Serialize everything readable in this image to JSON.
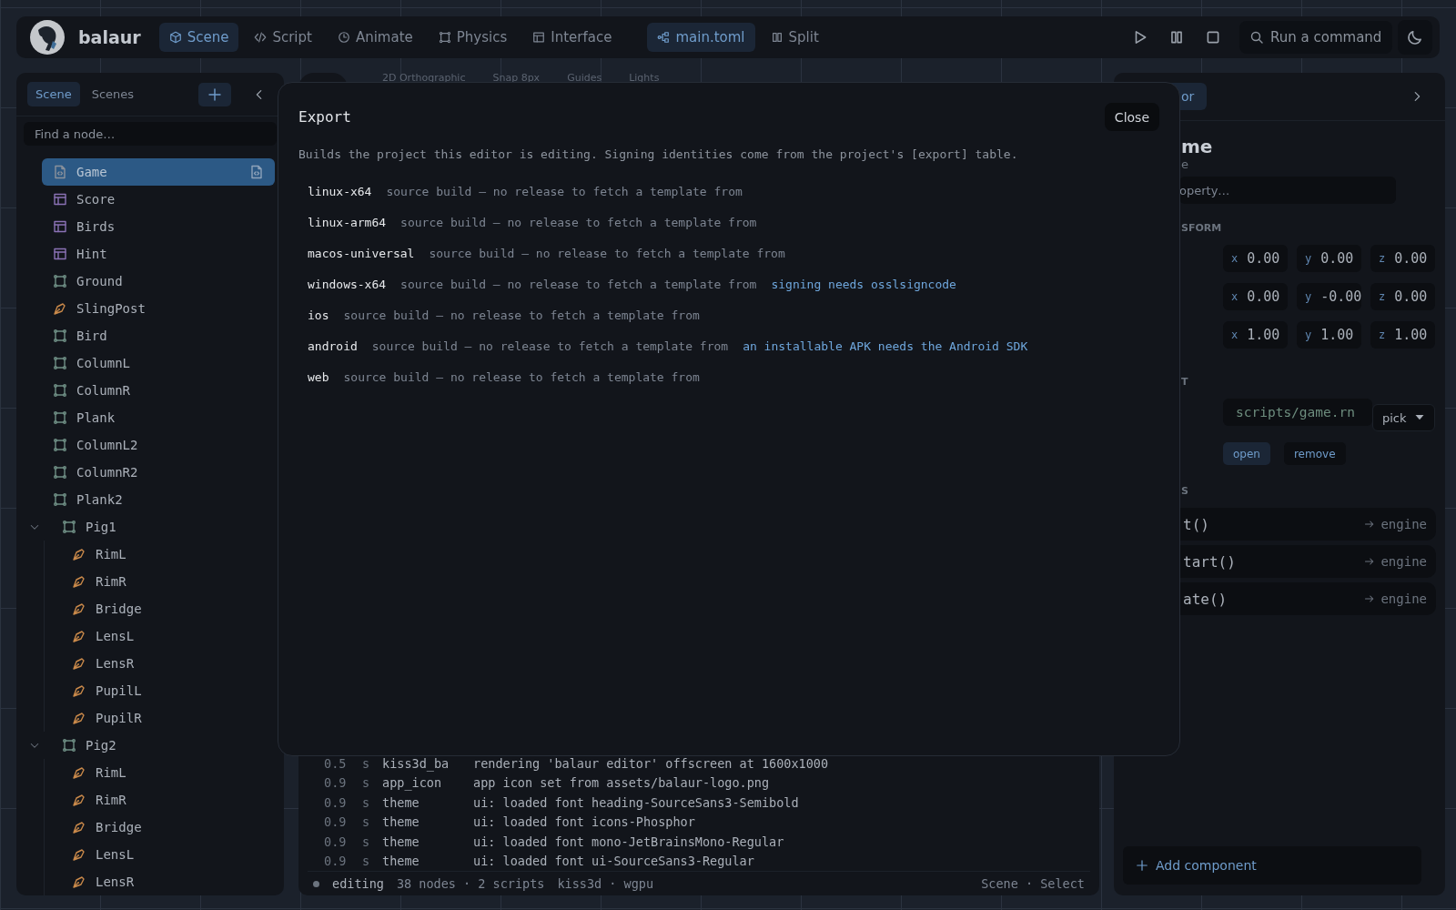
{
  "topbar": {
    "brand": "balaur",
    "tabs": [
      {
        "label": "Scene",
        "selected": true
      },
      {
        "label": "Script",
        "selected": false
      },
      {
        "label": "Animate",
        "selected": false
      },
      {
        "label": "Physics",
        "selected": false
      },
      {
        "label": "Interface",
        "selected": false
      }
    ],
    "file": {
      "label": "main.toml"
    },
    "split": {
      "label": "Split"
    },
    "command": {
      "placeholder": "Run a command"
    }
  },
  "scene_panel": {
    "tabs": [
      {
        "label": "Scene",
        "selected": true
      },
      {
        "label": "Scenes",
        "selected": false
      }
    ],
    "search": {
      "placeholder": "Find a node…"
    },
    "tree": [
      {
        "label": "Game",
        "kind": "script",
        "selected": true
      },
      {
        "label": "Score",
        "kind": "layout",
        "selected": false
      },
      {
        "label": "Birds",
        "kind": "layout",
        "selected": false
      },
      {
        "label": "Hint",
        "kind": "layout",
        "selected": false
      },
      {
        "label": "Ground",
        "kind": "body",
        "selected": false
      },
      {
        "label": "SlingPost",
        "kind": "shape",
        "selected": false
      },
      {
        "label": "Bird",
        "kind": "body",
        "selected": false
      },
      {
        "label": "ColumnL",
        "kind": "body",
        "selected": false
      },
      {
        "label": "ColumnR",
        "kind": "body",
        "selected": false
      },
      {
        "label": "Plank",
        "kind": "body",
        "selected": false
      },
      {
        "label": "ColumnL2",
        "kind": "body",
        "selected": false
      },
      {
        "label": "ColumnR2",
        "kind": "body",
        "selected": false
      },
      {
        "label": "Plank2",
        "kind": "body",
        "selected": false
      },
      {
        "label": "Pig1",
        "kind": "body",
        "selected": false,
        "expanded": true,
        "children": [
          {
            "label": "RimL",
            "kind": "shape",
            "selected": false
          },
          {
            "label": "RimR",
            "kind": "shape",
            "selected": false
          },
          {
            "label": "Bridge",
            "kind": "shape",
            "selected": false
          },
          {
            "label": "LensL",
            "kind": "shape",
            "selected": false
          },
          {
            "label": "LensR",
            "kind": "shape",
            "selected": false
          },
          {
            "label": "PupilL",
            "kind": "shape",
            "selected": false
          },
          {
            "label": "PupilR",
            "kind": "shape",
            "selected": false
          }
        ]
      },
      {
        "label": "Pig2",
        "kind": "body",
        "selected": false,
        "expanded": true,
        "children": [
          {
            "label": "RimL",
            "kind": "shape",
            "selected": false
          },
          {
            "label": "RimR",
            "kind": "shape",
            "selected": false
          },
          {
            "label": "Bridge",
            "kind": "shape",
            "selected": false
          },
          {
            "label": "LensL",
            "kind": "shape",
            "selected": false
          },
          {
            "label": "LensR",
            "kind": "shape",
            "selected": false
          }
        ]
      }
    ]
  },
  "viewport": {
    "toolbar": [
      "2D Orthographic",
      "Snap 8px",
      "Guides",
      "Lights"
    ]
  },
  "console": {
    "lines": [
      {
        "time": "0.5",
        "unit": "s",
        "source": "kiss3d_ba",
        "message": "rendering 'balaur editor' offscreen at 1600x1000"
      },
      {
        "time": "0.9",
        "unit": "s",
        "source": "app_icon",
        "message": "app icon set from assets/balaur-logo.png"
      },
      {
        "time": "0.9",
        "unit": "s",
        "source": "theme",
        "message": "ui: loaded font heading-SourceSans3-Semibold"
      },
      {
        "time": "0.9",
        "unit": "s",
        "source": "theme",
        "message": "ui: loaded font icons-Phosphor"
      },
      {
        "time": "0.9",
        "unit": "s",
        "source": "theme",
        "message": "ui: loaded font mono-JetBrainsMono-Regular"
      },
      {
        "time": "0.9",
        "unit": "s",
        "source": "theme",
        "message": "ui: loaded font ui-SourceSans3-Regular"
      }
    ]
  },
  "status_bar": {
    "mode": "editing",
    "counts": "38 nodes · 2 scripts",
    "backend": "kiss3d · wgpu",
    "context": "Scene · Select"
  },
  "inspector": {
    "tab": {
      "label": "or",
      "selected": true
    },
    "title": "me",
    "subtitle": "e",
    "search": {
      "placeholder": "operty…"
    },
    "transform": {
      "heading": "SFORM",
      "rows": [
        [
          {
            "axis": "x",
            "value": "0.00"
          },
          {
            "axis": "y",
            "value": "0.00"
          },
          {
            "axis": "z",
            "value": "0.00"
          }
        ],
        [
          {
            "axis": "x",
            "value": "0.00"
          },
          {
            "axis": "y",
            "value": "-0.00"
          },
          {
            "axis": "z",
            "value": "0.00"
          }
        ],
        [
          {
            "axis": "x",
            "value": "1.00"
          },
          {
            "axis": "y",
            "value": "1.00"
          },
          {
            "axis": "z",
            "value": "1.00"
          }
        ]
      ]
    },
    "script": {
      "heading": "T",
      "path": "scripts/game.rn",
      "pick": "pick",
      "open": "open",
      "remove": "remove"
    },
    "methods": {
      "heading": "S",
      "items": [
        {
          "name": "t()",
          "target": "engine"
        },
        {
          "name": "tart()",
          "target": "engine"
        },
        {
          "name": "ate()",
          "target": "engine"
        }
      ]
    },
    "add_component": "Add component"
  },
  "export_dialog": {
    "title": "Export",
    "close": "Close",
    "description": "Builds the project this editor is editing. Signing identities come from the project's [export] table.",
    "targets": [
      {
        "name": "linux-x64",
        "note": "source build — no release to fetch a template from"
      },
      {
        "name": "linux-arm64",
        "note": "source build — no release to fetch a template from"
      },
      {
        "name": "macos-universal",
        "note": "source build — no release to fetch a template from"
      },
      {
        "name": "windows-x64",
        "note": "source build — no release to fetch a template from",
        "warning": "signing needs osslsigncode"
      },
      {
        "name": "ios",
        "note": "source build — no release to fetch a template from"
      },
      {
        "name": "android",
        "note": "source build — no release to fetch a template from",
        "warning": "an installable APK needs the Android SDK"
      },
      {
        "name": "web",
        "note": "source build — no release to fetch a template from"
      }
    ]
  }
}
